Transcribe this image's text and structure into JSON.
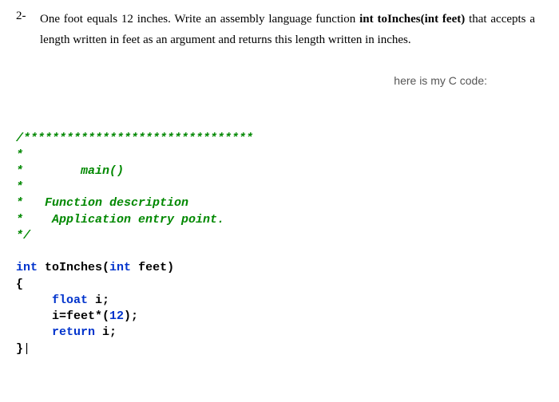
{
  "question": {
    "number": "2-",
    "text_before_fn": "One foot equals 12 inches. Write an assembly language  function   ",
    "fn_sig": "int toInches(int feet)",
    "text_after_fn": "   that accepts a length written in feet as an argument and returns this length written in inches."
  },
  "caption": "here is my C code:",
  "code": {
    "c1": "/********************************",
    "c2": "*",
    "c3_pre": "*        ",
    "c3_main": "main()",
    "c4": "*",
    "c5_pre": "*   ",
    "c5_text": "Function description",
    "c6_pre": "*    ",
    "c6_text": "Application entry point.",
    "c7": "*/",
    "kw_int": "int",
    "fn_name": " toInches",
    "open_paren": "(",
    "kw_int2": "int",
    "param_rest": " feet)",
    "brace_open": "{",
    "kw_float": "float",
    "decl_rest": " i;",
    "assign_pre": "     i=feet*(",
    "lit_12": "12",
    "assign_post": ");",
    "kw_return": "return",
    "ret_rest": " i;",
    "brace_close": "}",
    "cursor": "|"
  }
}
